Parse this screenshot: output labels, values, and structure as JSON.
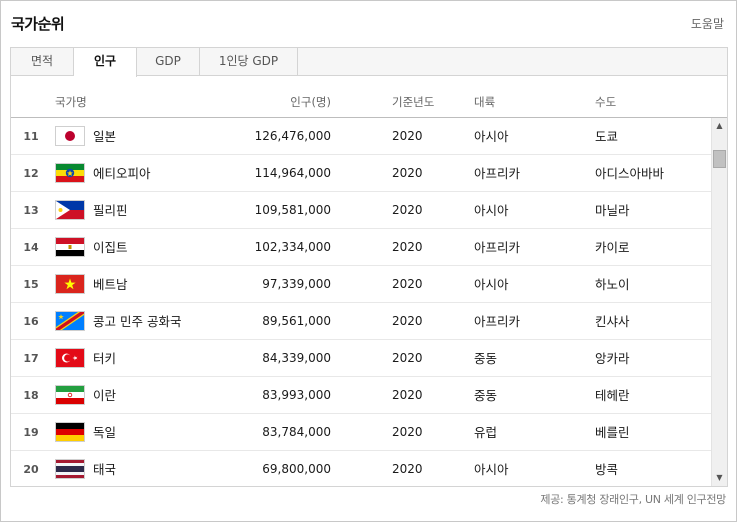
{
  "header": {
    "title": "국가순위",
    "help_label": "도움말"
  },
  "tabs": [
    {
      "label": "면적",
      "active": false
    },
    {
      "label": "인구",
      "active": true
    },
    {
      "label": "GDP",
      "active": false
    },
    {
      "label": "1인당 GDP",
      "active": false
    }
  ],
  "columns": {
    "country": "국가명",
    "population": "인구(명)",
    "year": "기준년도",
    "continent": "대륙",
    "capital": "수도"
  },
  "rows": [
    {
      "rank": "11",
      "flag": "japan-flag-icon",
      "country": "일본",
      "population": "126,476,000",
      "year": "2020",
      "continent": "아시아",
      "capital": "도쿄"
    },
    {
      "rank": "12",
      "flag": "ethiopia-flag-icon",
      "country": "에티오피아",
      "population": "114,964,000",
      "year": "2020",
      "continent": "아프리카",
      "capital": "아디스아바바"
    },
    {
      "rank": "13",
      "flag": "philippines-flag-icon",
      "country": "필리핀",
      "population": "109,581,000",
      "year": "2020",
      "continent": "아시아",
      "capital": "마닐라"
    },
    {
      "rank": "14",
      "flag": "egypt-flag-icon",
      "country": "이집트",
      "population": "102,334,000",
      "year": "2020",
      "continent": "아프리카",
      "capital": "카이로"
    },
    {
      "rank": "15",
      "flag": "vietnam-flag-icon",
      "country": "베트남",
      "population": "97,339,000",
      "year": "2020",
      "continent": "아시아",
      "capital": "하노이"
    },
    {
      "rank": "16",
      "flag": "dr-congo-flag-icon",
      "country": "콩고 민주 공화국",
      "population": "89,561,000",
      "year": "2020",
      "continent": "아프리카",
      "capital": "킨샤사"
    },
    {
      "rank": "17",
      "flag": "turkey-flag-icon",
      "country": "터키",
      "population": "84,339,000",
      "year": "2020",
      "continent": "중동",
      "capital": "앙카라"
    },
    {
      "rank": "18",
      "flag": "iran-flag-icon",
      "country": "이란",
      "population": "83,993,000",
      "year": "2020",
      "continent": "중동",
      "capital": "테헤란"
    },
    {
      "rank": "19",
      "flag": "germany-flag-icon",
      "country": "독일",
      "population": "83,784,000",
      "year": "2020",
      "continent": "유럽",
      "capital": "베를린"
    },
    {
      "rank": "20",
      "flag": "thailand-flag-icon",
      "country": "태국",
      "population": "69,800,000",
      "year": "2020",
      "continent": "아시아",
      "capital": "방콕"
    }
  ],
  "footer": {
    "source": "제공: 통계청 장래인구, UN 세계 인구전망"
  }
}
